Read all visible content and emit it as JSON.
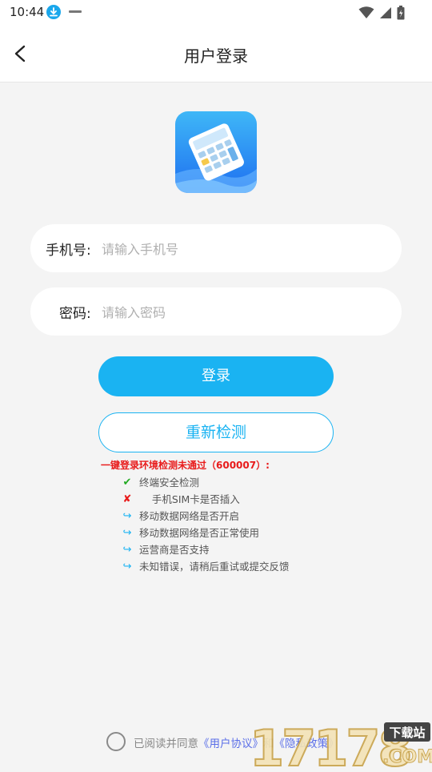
{
  "status_bar": {
    "time": "10:44",
    "icons": [
      "download-icon",
      "notification-icon",
      "wifi-icon",
      "signal-icon",
      "battery-icon"
    ]
  },
  "header": {
    "title": "用户登录",
    "back_icon": "chevron-left-icon"
  },
  "form": {
    "phone": {
      "label": "手机号:",
      "placeholder": "请输入手机号",
      "value": ""
    },
    "password": {
      "label": "密码:",
      "placeholder": "请输入密码",
      "value": ""
    }
  },
  "buttons": {
    "login": "登录",
    "retry": "重新检测"
  },
  "check": {
    "title": "一键登录环境检测未通过（600007）:",
    "items": [
      {
        "status": "pass",
        "icon": "✔",
        "color": "#22aa22",
        "text": "终端安全检测"
      },
      {
        "status": "fail",
        "icon": "✘",
        "color": "#e81b1b",
        "text": "    手机SIM卡是否插入"
      },
      {
        "status": "pending",
        "icon": "↪",
        "color": "#1ab3f2",
        "text": "移动数据网络是否开启"
      },
      {
        "status": "pending",
        "icon": "↪",
        "color": "#1ab3f2",
        "text": "移动数据网络是否正常使用"
      },
      {
        "status": "pending",
        "icon": "↪",
        "color": "#1ab3f2",
        "text": "运营商是否支持"
      },
      {
        "status": "pending",
        "icon": "↪",
        "color": "#1ab3f2",
        "text": "未知错误，请稍后重试或提交反馈"
      }
    ]
  },
  "footer": {
    "prefix": "已阅读并同意",
    "user_agreement": "《用户协议》",
    "and": "和",
    "privacy_policy": "《隐私政策》",
    "agreed": false
  },
  "watermark": {
    "number": "17178",
    "badge": "下载站",
    "domain": ".COM"
  },
  "colors": {
    "accent": "#1ab3f2",
    "error": "#e81b1b",
    "link": "#5a6ee8"
  }
}
